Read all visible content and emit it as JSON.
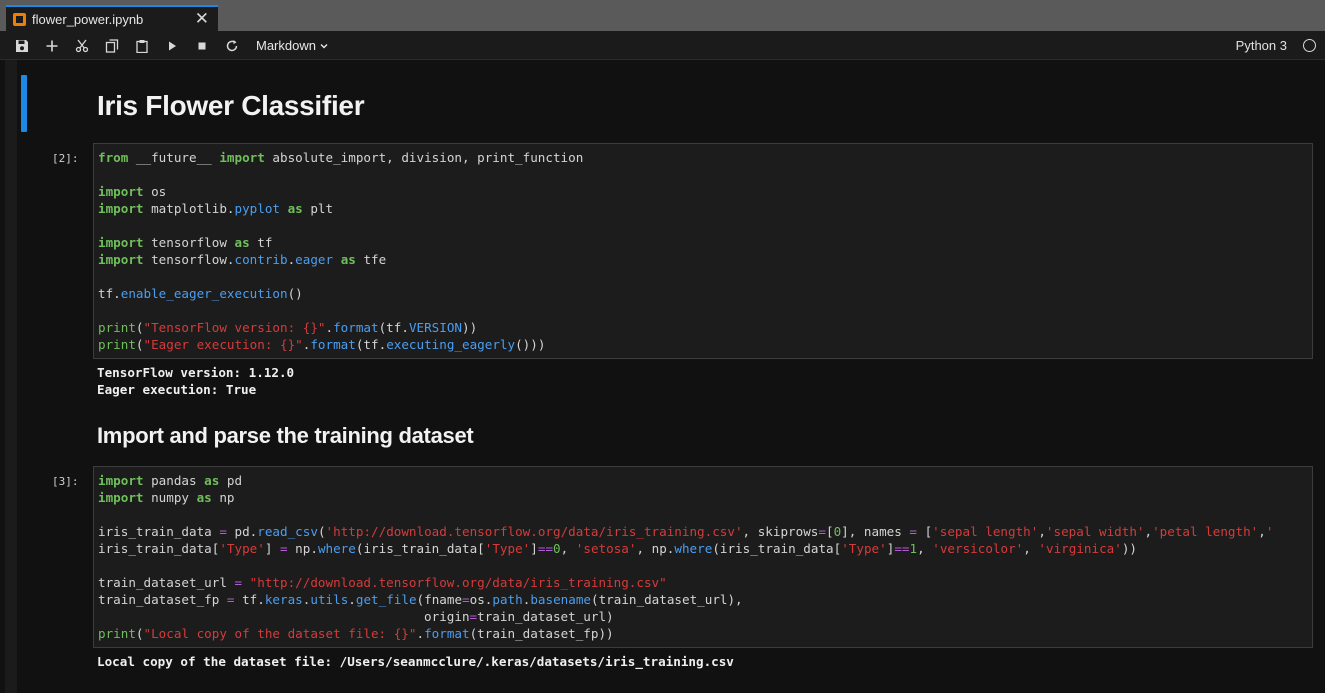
{
  "tab": {
    "title": "flower_power.ipynb",
    "close": "✕"
  },
  "toolbar": {
    "cell_type": "Markdown",
    "kernel_name": "Python 3"
  },
  "cells": {
    "title": "Iris Flower Classifier",
    "cell2": {
      "prompt": "[2]:",
      "output": [
        "TensorFlow version: 1.12.0",
        "Eager execution: True"
      ]
    },
    "heading2": "Import and parse the training dataset",
    "cell3": {
      "prompt": "[3]:",
      "output": [
        "Local copy of the dataset file: /Users/seanmcclure/.keras/datasets/iris_training.csv"
      ]
    }
  }
}
